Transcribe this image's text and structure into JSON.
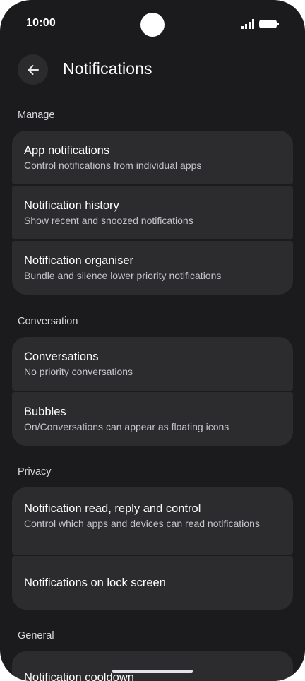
{
  "status_bar": {
    "time": "10:00",
    "battery_level": 1.0
  },
  "app_bar": {
    "title": "Notifications",
    "back_icon": "arrow-left-icon"
  },
  "sections": {
    "manage": {
      "header": "Manage",
      "items": [
        {
          "title": "App notifications",
          "subtitle": "Control notifications from individual apps"
        },
        {
          "title": "Notification history",
          "subtitle": "Show recent and snoozed notifications"
        },
        {
          "title": "Notification organiser",
          "subtitle": "Bundle and silence lower priority notifications"
        }
      ]
    },
    "conversation": {
      "header": "Conversation",
      "items": [
        {
          "title": "Conversations",
          "subtitle": "No priority conversations"
        },
        {
          "title": "Bubbles",
          "subtitle": "On/Conversations can appear as floating icons"
        }
      ]
    },
    "privacy": {
      "header": "Privacy",
      "items": [
        {
          "title": "Notification read, reply and control",
          "subtitle": "Control which apps and devices can read notifications"
        },
        {
          "title": "Notifications on lock screen"
        }
      ]
    },
    "general": {
      "header": "General",
      "items": [
        {
          "title": "Notification cooldown"
        }
      ]
    }
  },
  "colors": {
    "background": "#1b1b1d",
    "card": "#2c2c2f",
    "text_primary": "#ffffff",
    "text_secondary": "#c5c5ca"
  }
}
